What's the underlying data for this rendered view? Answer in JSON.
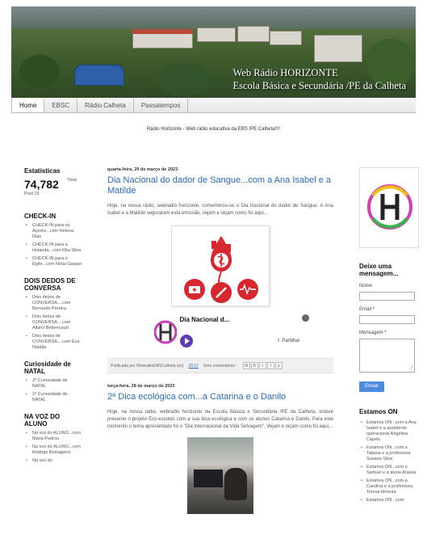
{
  "header": {
    "banner_line1": "Web Rádio HORIZONTE",
    "banner_line2": "Escola Básica e Secundária /PE da Calheta"
  },
  "tabs": [
    {
      "label": "Home",
      "active": true
    },
    {
      "label": "EBSC",
      "active": false
    },
    {
      "label": "Rádio Calheta",
      "active": false
    },
    {
      "label": "Passatempos",
      "active": false
    }
  ],
  "description": "Rádio Horizonte - Web rádio educativa da EBS /PE Calheta!!!!",
  "left": {
    "stats_title": "Estatísticas",
    "stats_number": "74,782",
    "stats_total_label": "Total",
    "stats_post": "Post 15",
    "sections": [
      {
        "title": "CHECK-IN",
        "items": [
          "CHECK-IN para os Açores...com Helena Dias",
          "CHECK-IN para a Holanda...com Rita Silva",
          "CHECK-IN para o Egito...com Nídia Gaspar"
        ]
      },
      {
        "title": "DOIS DEDOS DE CONVERSA",
        "items": [
          "Dois dedos de CONVERSA....com Bernardo Pereira",
          "Dois dedos de CONVERSA....com Albino Bettencourt",
          "Dois dedos de CONVERSA....com Eva Natália"
        ]
      },
      {
        "title": "Curiosidade de NATAL",
        "items": [
          "2ª Curiosidade de NATAL",
          "1ª Curiosidade de NATAL"
        ]
      },
      {
        "title": "NA VOZ DO ALUNO",
        "items": [
          "Na voz do ALUNO...com Maria Pedrou",
          "Na voz do ALUNO...com Rodrigo Bomageiro",
          "Na voz do"
        ]
      }
    ]
  },
  "posts": [
    {
      "date": "quarta-feira, 29 de março de 2023",
      "title": "Dia Nacional do dador de Sangue...com a Ana Isabel e a Matilde",
      "body": "Hoje, na nossa rádio, webradio horizonte, comemorou-se o Dia Nacional do dador de Sangue. A Ana Isabel e a Matilde seguraram esta emissão, vejam e oiçam como foi aqui...",
      "player_title": "Dia Nacional d...",
      "player_share": "Partilhar",
      "footer_prefix": "Publicada por WebradioEBSCalheta à(s)",
      "footer_time": "20:17",
      "footer_comments": "Sem comentários :"
    },
    {
      "date": "terça-feira, 28 de março de 2023",
      "title": "2ª Dica ecológica com...a Catarina e o Danilo",
      "body": "Hoje, na nossa rádio, webradio horizonte da Escola Básica e Secundária /PE da Calheta, esteve presente o projeto Eco-escolas com a sua dica ecológica e com os alunos Catarina e Danilo. Para este momento o tema apresentado foi o \"Dia internacional da Vida Selvagem\". Vejam e oiçam como foi aqui..."
    }
  ],
  "right": {
    "message_title": "Deixe uma mensagem...",
    "name_label": "Nome",
    "email_label": "Email",
    "message_label": "Mensagem",
    "required_mark": "*",
    "send_label": "Enviar",
    "on_title": "Estamos ON",
    "on_items": [
      "Estamos ON...com a Ana Isabel e a assistente operacional Angelina Capelo",
      "Estamos ON...com a Tatiana e a professora Susana Silva",
      "Estamos ON...com o Samuel e a aluna Anaísa",
      "Estamos ON...com a Carolina e a professora Teresa Moreira",
      "Estamos ON...com"
    ]
  },
  "colors": {
    "link": "#2c6bb8",
    "button": "#4d8be0",
    "play": "#5b3fb0"
  }
}
